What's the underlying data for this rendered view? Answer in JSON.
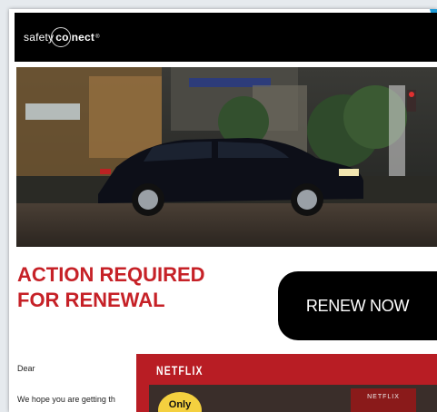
{
  "brand": {
    "prefix": "safety",
    "suffix": "nect",
    "conn_letters": "co",
    "reg": "®"
  },
  "headline": {
    "line1": "ACTION REQUIRED",
    "line2": "FOR RENEWAL"
  },
  "cta": {
    "label": "RENEW NOW"
  },
  "greeting": "Dear",
  "body": {
    "line1": "We hope you are getting th"
  },
  "promo": {
    "logo": "NETFLIX",
    "badge": "Only",
    "card": "NETFLIX"
  },
  "colors": {
    "headline_red": "#c62127",
    "header_black": "#000000",
    "netflix_red": "#b81d24",
    "accent_blue": "#1e9bd7"
  },
  "icons": {
    "logo": "safety-connect-logo",
    "car": "car-image"
  }
}
